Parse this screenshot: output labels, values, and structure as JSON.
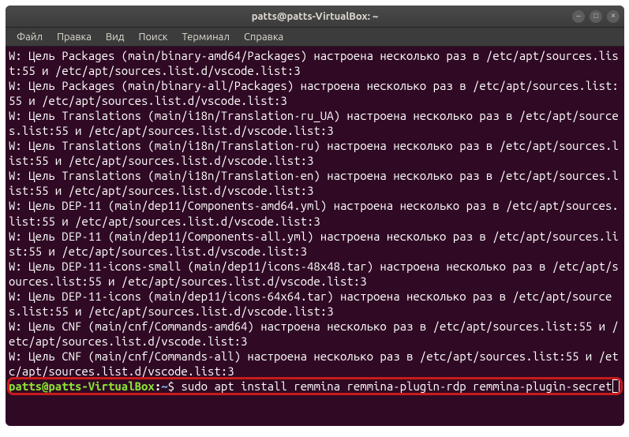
{
  "titlebar": {
    "title": "patts@patts-VirtualBox: ~"
  },
  "window_controls": {
    "minimize": "–",
    "maximize": "□",
    "close": "×"
  },
  "menu": {
    "file": "Файл",
    "edit": "Правка",
    "view": "Вид",
    "search": "Поиск",
    "terminal": "Терминал",
    "help": "Справка"
  },
  "output": [
    "W: Цель Packages (main/binary-amd64/Packages) настроена несколько раз в /etc/apt/sources.list:55 и /etc/apt/sources.list.d/vscode.list:3",
    "W: Цель Packages (main/binary-all/Packages) настроена несколько раз в /etc/apt/sources.list:55 и /etc/apt/sources.list.d/vscode.list:3",
    "W: Цель Translations (main/i18n/Translation-ru_UA) настроена несколько раз в /etc/apt/sources.list:55 и /etc/apt/sources.list.d/vscode.list:3",
    "W: Цель Translations (main/i18n/Translation-ru) настроена несколько раз в /etc/apt/sources.list:55 и /etc/apt/sources.list.d/vscode.list:3",
    "W: Цель Translations (main/i18n/Translation-en) настроена несколько раз в /etc/apt/sources.list:55 и /etc/apt/sources.list.d/vscode.list:3",
    "W: Цель DEP-11 (main/dep11/Components-amd64.yml) настроена несколько раз в /etc/apt/sources.list:55 и /etc/apt/sources.list.d/vscode.list:3",
    "W: Цель DEP-11 (main/dep11/Components-all.yml) настроена несколько раз в /etc/apt/sources.list:55 и /etc/apt/sources.list.d/vscode.list:3",
    "W: Цель DEP-11-icons-small (main/dep11/icons-48x48.tar) настроена несколько раз в /etc/apt/sources.list:55 и /etc/apt/sources.list.d/vscode.list:3",
    "W: Цель DEP-11-icons (main/dep11/icons-64x64.tar) настроена несколько раз в /etc/apt/sources.list:55 и /etc/apt/sources.list.d/vscode.list:3",
    "W: Цель CNF (main/cnf/Commands-amd64) настроена несколько раз в /etc/apt/sources.list:55 и /etc/apt/sources.list.d/vscode.list:3",
    "W: Цель CNF (main/cnf/Commands-all) настроена несколько раз в /etc/apt/sources.list:55 и /etc/apt/sources.list.d/vscode.list:3"
  ],
  "prompt": {
    "user_host": "patts@patts-VirtualBox",
    "colon": ":",
    "path": "~",
    "dollar": "$",
    "command": "sudo apt install remmina remmina-plugin-rdp remmina-plugin-secret"
  }
}
